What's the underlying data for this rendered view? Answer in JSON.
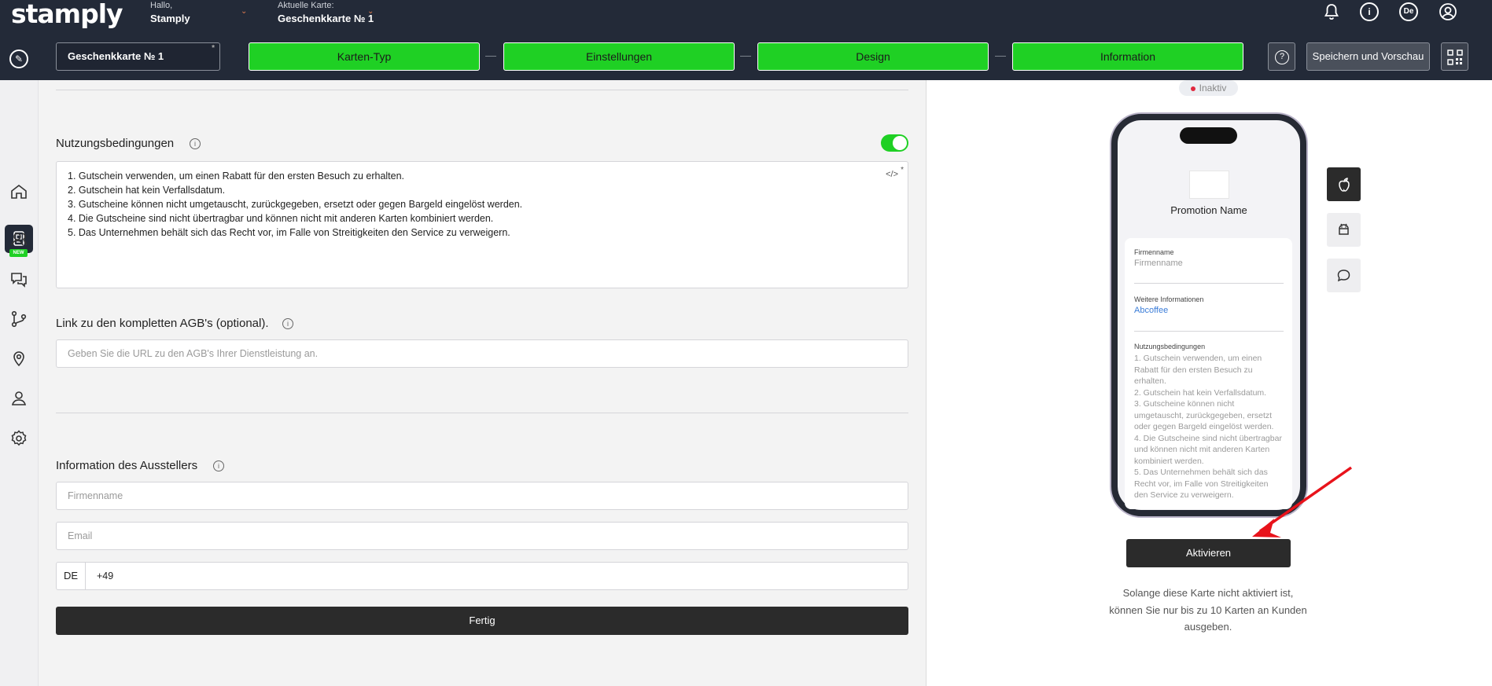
{
  "header": {
    "logo": "stamply",
    "greeting_label": "Hallo,",
    "user_name": "Stamply",
    "current_card_label": "Aktuelle Karte:",
    "current_card_name": "Geschenkkarte № 1",
    "language": "De"
  },
  "toolbar": {
    "card_name": "Geschenkkarte № 1",
    "card_name_mark": "*",
    "steps": [
      "Karten-Typ",
      "Einstellungen",
      "Design",
      "Information"
    ],
    "help_label": "?",
    "save_label": "Speichern und Vorschau"
  },
  "sidebar": {
    "new_badge": "NEW",
    "items": [
      "home-icon",
      "card-icon",
      "customers-icon",
      "chat-icon",
      "flow-icon",
      "location-icon",
      "user-icon",
      "settings-icon"
    ]
  },
  "form": {
    "terms_label": "Nutzungsbedingungen",
    "terms_enabled": true,
    "terms_code_icon": "</>",
    "terms_mark": "*",
    "terms_lines": [
      "1. Gutschein verwenden, um einen Rabatt für den ersten Besuch zu erhalten.",
      "2. Gutschein hat kein Verfallsdatum.",
      "3. Gutscheine können nicht umgetauscht, zurückgegeben, ersetzt oder gegen Bargeld eingelöst werden.",
      "4. Die Gutscheine sind nicht übertragbar und können nicht mit anderen Karten kombiniert werden.",
      "5. Das Unternehmen behält sich das Recht vor, im Falle von Streitigkeiten den Service zu verweigern."
    ],
    "agb_label": "Link zu den kompletten AGB's (optional).",
    "agb_placeholder": "Geben Sie die URL zu den AGB's Ihrer Dienstleistung an.",
    "issuer_label": "Information des Ausstellers",
    "company_placeholder": "Firmenname",
    "email_placeholder": "Email",
    "phone_country": "DE",
    "phone_value": "+49",
    "done_label": "Fertig"
  },
  "preview": {
    "status_label": "Inaktiv",
    "status_color": "#e0283e",
    "promotion_name": "Promotion Name",
    "company_label": "Firmenname",
    "company_value": "Firmenname",
    "more_info_label": "Weitere Informationen",
    "more_info_value": "Abcoffee",
    "terms_label": "Nutzungsbedingungen",
    "terms_text": "1. Gutschein verwenden, um einen Rabatt für den ersten Besuch zu erhalten.\n2. Gutschein hat kein Verfallsdatum.\n3. Gutscheine können nicht umgetauscht, zurückgegeben, ersetzt oder gegen Bargeld eingelöst werden.\n4. Die Gutscheine sind nicht übertragbar und können nicht mit anderen Karten kombiniert werden.\n5. Das Unternehmen behält sich das Recht vor, im Falle von Streitigkeiten den Service zu verweigern.",
    "platforms": [
      "apple-icon",
      "android-icon",
      "chat-bubble-icon"
    ],
    "activate_label": "Aktivieren",
    "note": "Solange diese Karte nicht aktiviert ist, können Sie nur bis zu 10 Karten an Kunden ausgeben."
  },
  "colors": {
    "header_bg": "#232a38",
    "step_green": "#1fd024",
    "arrow_red": "#e8131b"
  }
}
